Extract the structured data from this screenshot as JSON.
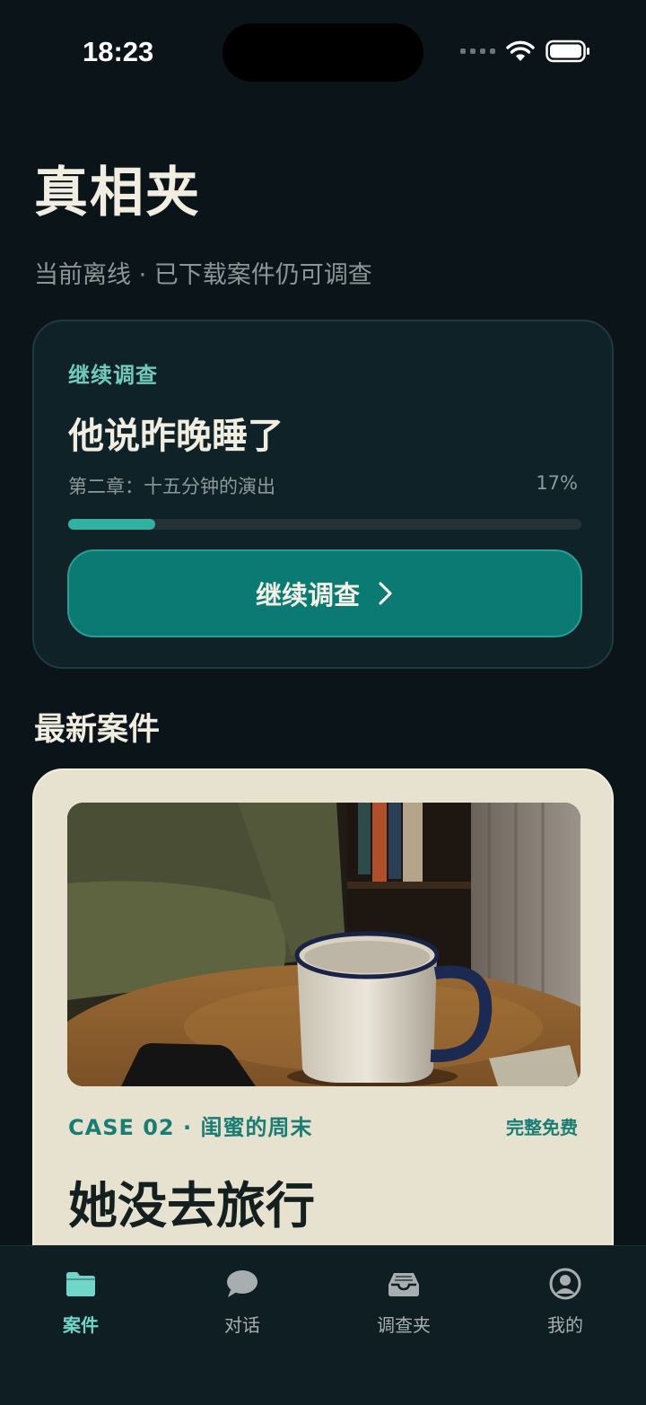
{
  "status_bar": {
    "time": "18:23"
  },
  "header": {
    "title": "真相夹",
    "subtitle": "当前离线 · 已下载案件仍可调查"
  },
  "continue_card": {
    "eyebrow": "继续调查",
    "title": "他说昨晚睡了",
    "chapter": "第二章：十五分钟的演出",
    "percent_label": "17%",
    "progress": 0.17,
    "button_label": "继续调查"
  },
  "latest": {
    "section_title": "最新案件",
    "case": {
      "meta": "CASE 02 · 闺蜜的周末",
      "badge": "完整免费",
      "title": "她没去旅行"
    }
  },
  "tabs": [
    {
      "label": "案件",
      "icon": "folder-icon",
      "active": true
    },
    {
      "label": "对话",
      "icon": "chat-bubble-icon",
      "active": false
    },
    {
      "label": "调查夹",
      "icon": "inbox-tray-icon",
      "active": false
    },
    {
      "label": "我的",
      "icon": "user-circle-icon",
      "active": false
    }
  ],
  "colors": {
    "background": "#0b1519",
    "accent": "#0a7a72",
    "accent_light": "#6fcbbd",
    "card_cream": "#e7e1d0"
  }
}
